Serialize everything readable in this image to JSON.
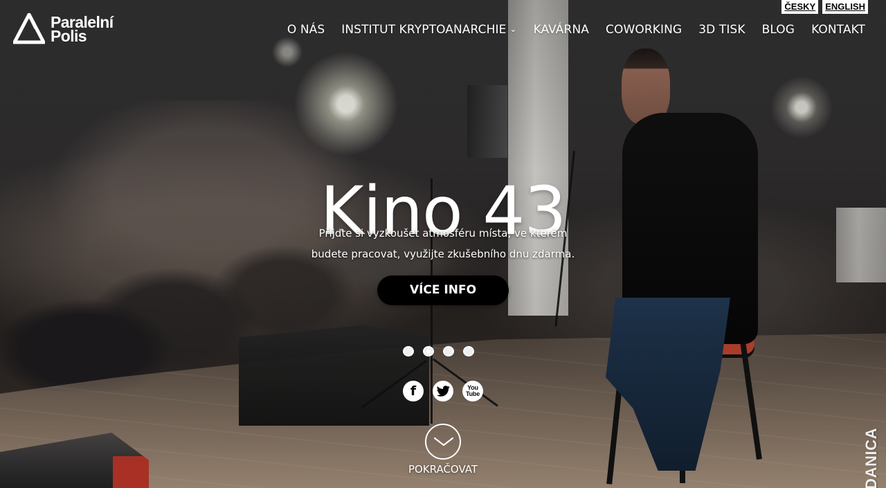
{
  "header": {
    "logo": {
      "line1": "Paralelní",
      "line2": "Polis"
    },
    "language_switch": [
      {
        "label": "ČESKY"
      },
      {
        "label": "ENGLISH"
      }
    ],
    "nav": [
      {
        "label": "O NÁS"
      },
      {
        "label": "INSTITUT KRYPTOANARCHIE",
        "icon": "chevron-down-icon"
      },
      {
        "label": "KAVÁRNA"
      },
      {
        "label": "COWORKING"
      },
      {
        "label": "3D TISK"
      },
      {
        "label": "BLOG"
      },
      {
        "label": "KONTAKT"
      }
    ]
  },
  "hero": {
    "title": "Kino 43",
    "subtitle_line1": "Přijďte si vyzkoušet atmosféru místa, ve kterém",
    "subtitle_line2": "budete pracovat, využijte zkušebního dnu zdarma.",
    "cta_label": "VÍCE INFO",
    "slider": {
      "count": 4,
      "active_index": 1
    },
    "social": [
      {
        "name": "facebook-icon",
        "glyph": "f"
      },
      {
        "name": "twitter-icon",
        "glyph": "t"
      },
      {
        "name": "youtube-icon",
        "line1": "You",
        "line2": "Tube"
      }
    ],
    "continue_label": "POKRAČOVAT"
  },
  "photo_credit": "DANICA KOVACEVIC",
  "colors": {
    "cta_background": "#000000",
    "text": "#ffffff",
    "language_background": "#ffffff"
  }
}
